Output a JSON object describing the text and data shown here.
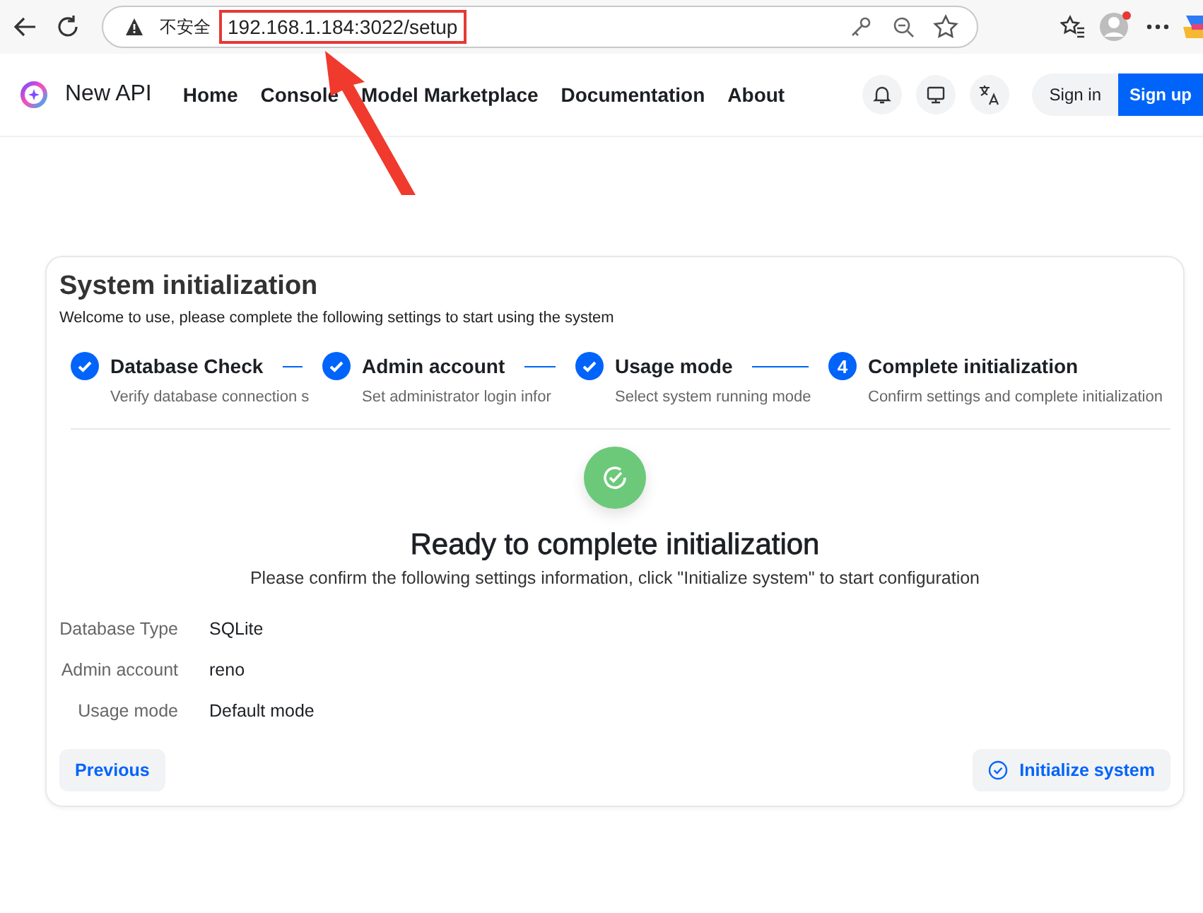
{
  "browser": {
    "security_label": "不安全",
    "url": "192.168.1.184:3022/setup"
  },
  "header": {
    "brand": "New API",
    "nav": [
      "Home",
      "Console",
      "Model Marketplace",
      "Documentation",
      "About"
    ],
    "sign_in": "Sign in",
    "sign_up": "Sign up"
  },
  "card": {
    "title": "System initialization",
    "subtitle": "Welcome to use, please complete the following settings to start using the system",
    "steps": [
      {
        "kind": "done",
        "title": "Database Check",
        "description": "Verify database connection s"
      },
      {
        "kind": "done",
        "title": "Admin account",
        "description": "Set administrator login infor"
      },
      {
        "kind": "done",
        "title": "Usage mode",
        "description": "Select system running mode"
      },
      {
        "kind": "current",
        "number": "4",
        "title": "Complete initialization",
        "description": "Confirm settings and complete initialization"
      }
    ],
    "heading": "Ready to complete initialization",
    "message": "Please confirm the following settings information, click \"Initialize system\" to start configuration",
    "settings": [
      {
        "label": "Database Type",
        "value": "SQLite"
      },
      {
        "label": "Admin account",
        "value": "reno"
      },
      {
        "label": "Usage mode",
        "value": "Default mode"
      }
    ],
    "previous": "Previous",
    "initialize": "Initialize system"
  }
}
